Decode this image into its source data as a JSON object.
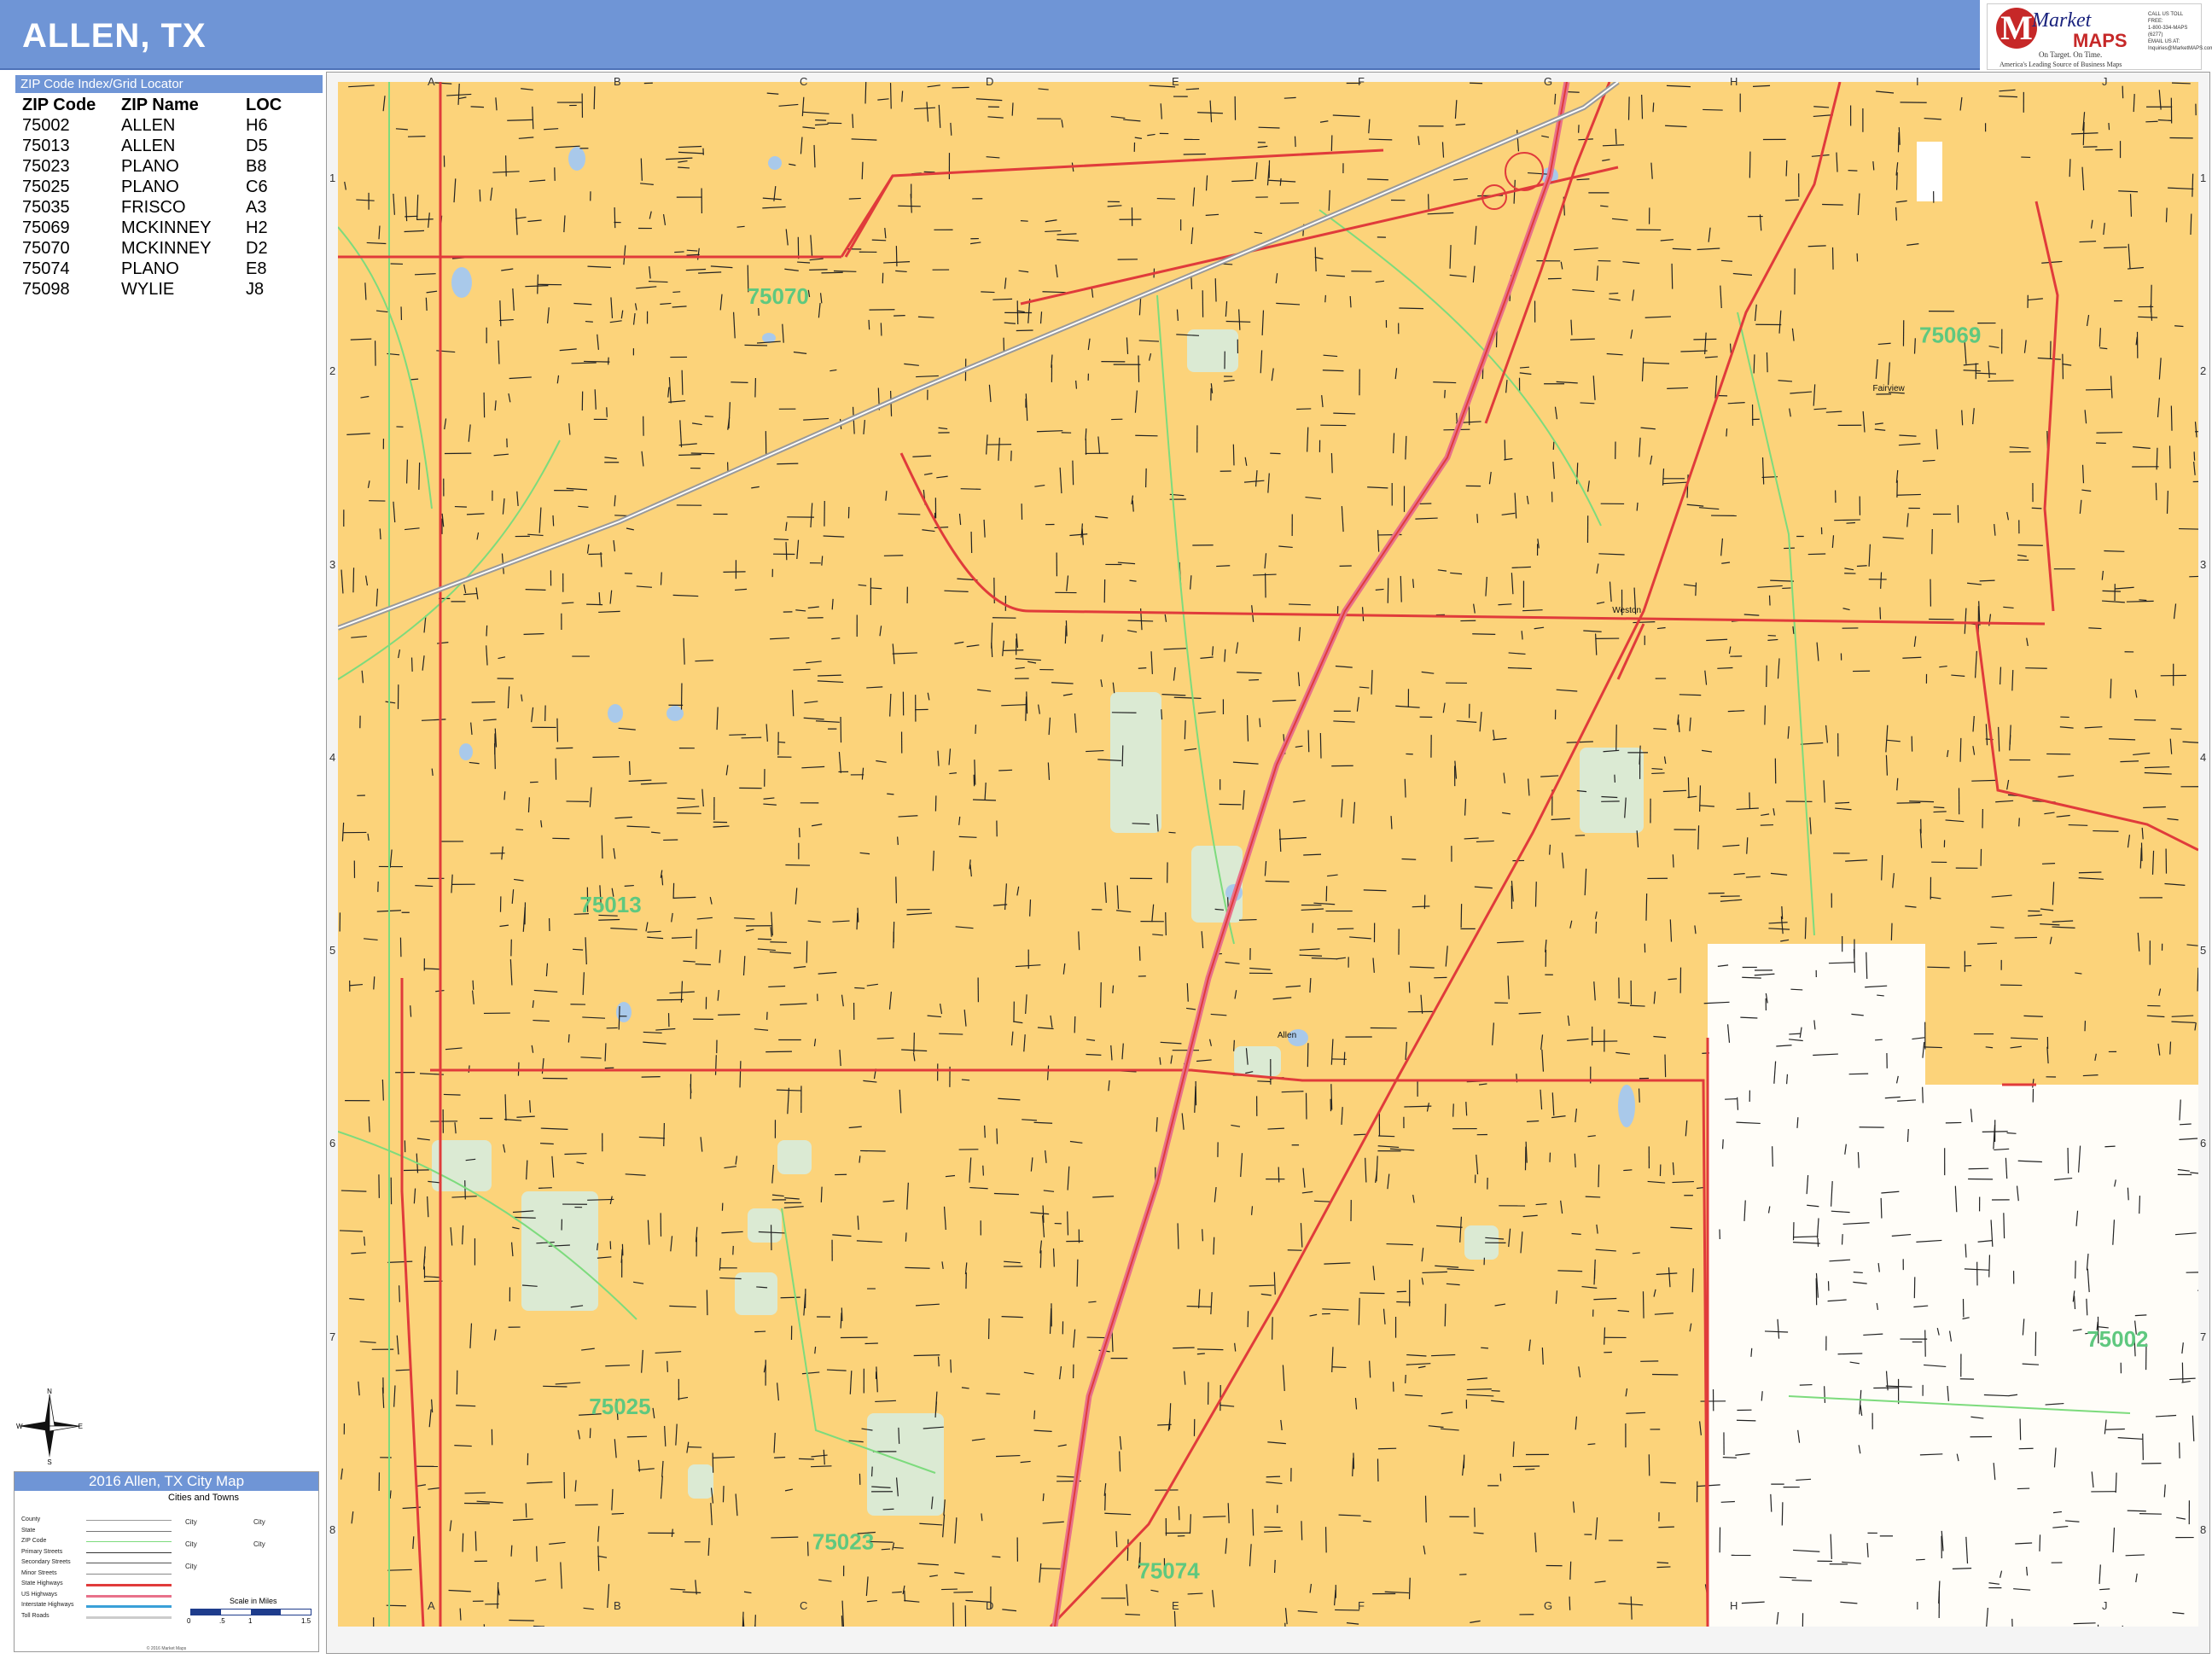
{
  "header": {
    "title": "ALLEN, TX"
  },
  "logo": {
    "brand_top": "Market",
    "brand_bottom": "MAPS",
    "tagline": "On Target. On Time.",
    "subline": "America's Leading Source of Business Maps",
    "contact_lines": [
      "CALL US TOLL FREE:",
      "1-800-334-MAPS (6277)",
      "EMAIL US AT:",
      "Inquiries@MarketMAPS.com"
    ],
    "initial": "M"
  },
  "zip_index": {
    "title": "ZIP Code Index/Grid Locator",
    "columns": [
      "ZIP Code",
      "ZIP Name",
      "LOC"
    ],
    "rows": [
      [
        "75002",
        "ALLEN",
        "H6"
      ],
      [
        "75013",
        "ALLEN",
        "D5"
      ],
      [
        "75023",
        "PLANO",
        "B8"
      ],
      [
        "75025",
        "PLANO",
        "C6"
      ],
      [
        "75035",
        "FRISCO",
        "A3"
      ],
      [
        "75069",
        "MCKINNEY",
        "H2"
      ],
      [
        "75070",
        "MCKINNEY",
        "D2"
      ],
      [
        "75074",
        "PLANO",
        "E8"
      ],
      [
        "75098",
        "WYLIE",
        "J8"
      ]
    ]
  },
  "grid": {
    "columns": [
      "A",
      "B",
      "C",
      "D",
      "E",
      "F",
      "G",
      "H",
      "I",
      "J"
    ],
    "rows": [
      "1",
      "2",
      "3",
      "4",
      "5",
      "6",
      "7",
      "8"
    ]
  },
  "map_labels": {
    "zips": [
      {
        "text": "75070",
        "col": 2.2,
        "row": 1.15
      },
      {
        "text": "75069",
        "col": 8.5,
        "row": 1.35
      },
      {
        "text": "75013",
        "col": 1.3,
        "row": 4.3
      },
      {
        "text": "75025",
        "col": 1.35,
        "row": 6.9
      },
      {
        "text": "75002",
        "col": 9.4,
        "row": 6.55
      },
      {
        "text": "75023",
        "col": 2.55,
        "row": 7.6
      },
      {
        "text": "75074",
        "col": 4.3,
        "row": 7.75
      }
    ],
    "places": [
      {
        "text": "Allen",
        "col": 5.05,
        "row": 4.95
      },
      {
        "text": "Fairview",
        "col": 8.25,
        "row": 1.6
      },
      {
        "text": "Weston",
        "col": 6.85,
        "row": 2.75
      }
    ]
  },
  "compass": {
    "n": "N",
    "s": "S",
    "e": "E",
    "w": "W"
  },
  "legend": {
    "title": "2016 Allen, TX City Map",
    "subtitle": "Cities and Towns",
    "rows": [
      "County",
      "State",
      "ZIP Code",
      "Primary Streets",
      "Secondary Streets",
      "Minor Streets",
      "State Highways",
      "US Highways",
      "Interstate Highways",
      "Toll Roads"
    ],
    "city_marks": [
      "City",
      "City",
      "City",
      "City",
      "City"
    ],
    "scale_label": "Scale in Miles",
    "scale_ticks": [
      "0",
      ".5",
      "1",
      "1.5"
    ],
    "footer": "© 2016 Market Maps"
  },
  "colors": {
    "land": "#fcd37a",
    "park": "#dbead3",
    "water": "#a9c9ea",
    "arterial": "#e03b3b",
    "highway": "#e8718a",
    "zip_line": "#7ddb7d",
    "zip_label": "#5fc87f",
    "street": "#222222"
  }
}
